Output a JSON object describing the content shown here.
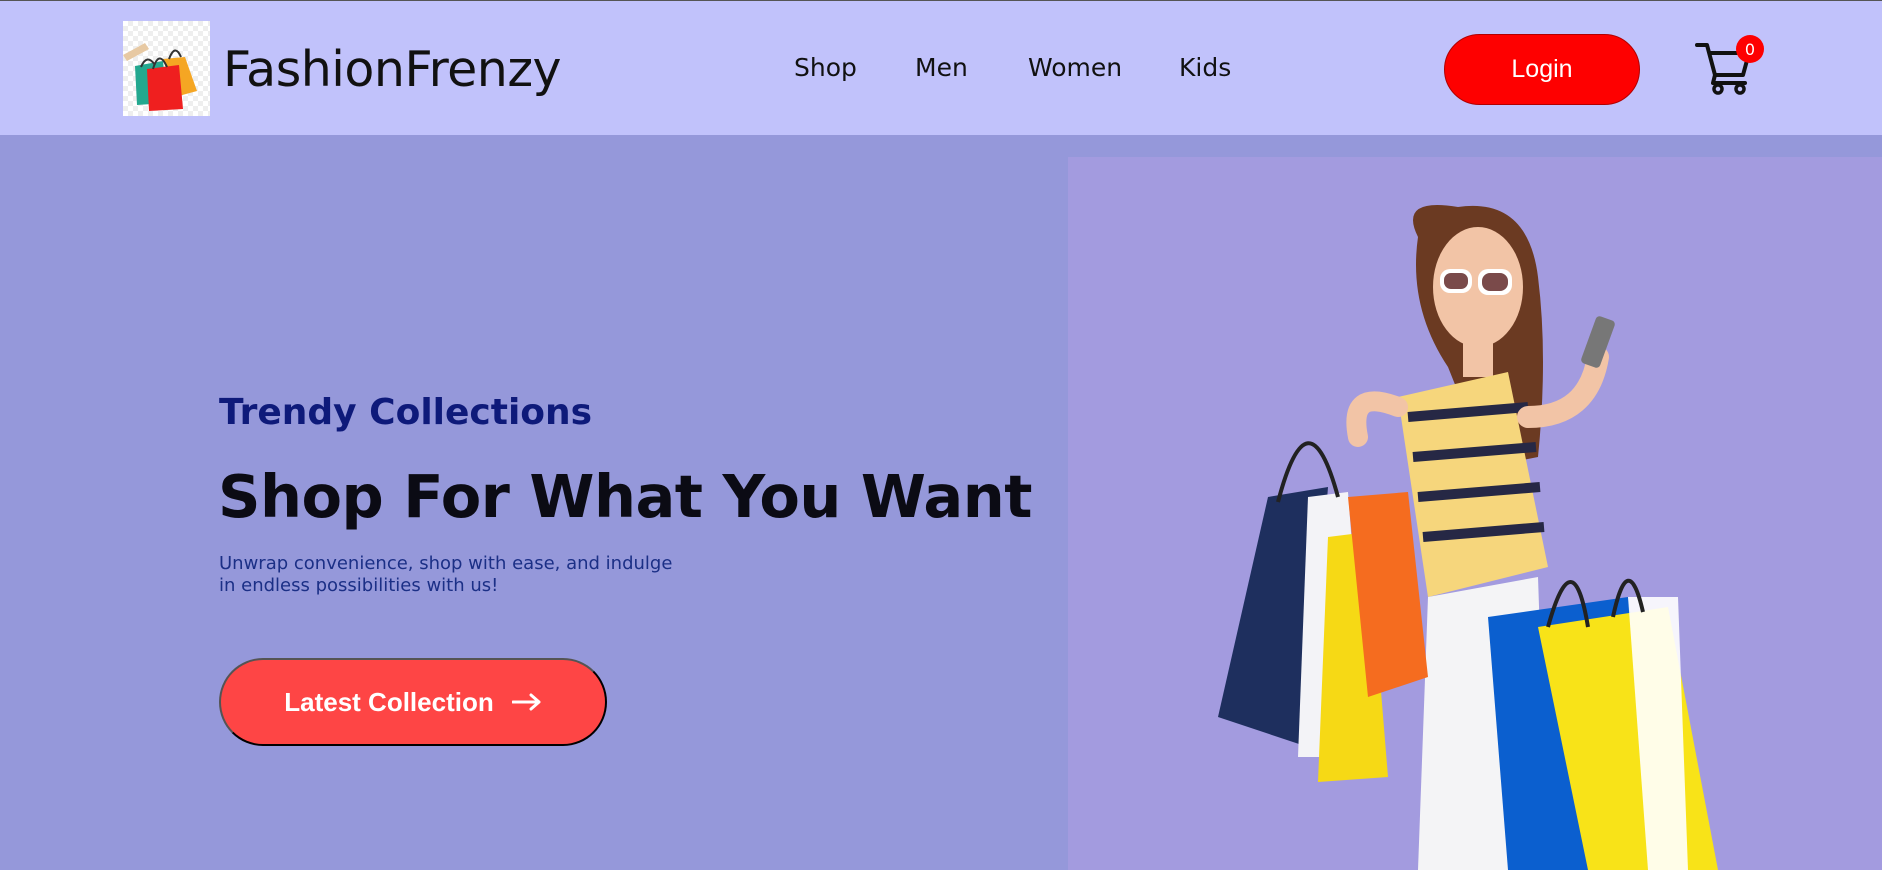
{
  "header": {
    "brand_name": "FashionFrenzy",
    "logo_icon": "shopping-bags-icon",
    "nav": [
      "Shop",
      "Men",
      "Women",
      "Kids"
    ],
    "login_label": "Login",
    "cart_icon": "cart-icon",
    "cart_count": "0"
  },
  "hero": {
    "kicker": "Trendy Collections",
    "headline": "Shop For What You Want",
    "subtext": "Unwrap convenience, shop with ease, and indulge in endless possibilities with us!",
    "cta_label": "Latest Collection",
    "cta_icon": "arrow-right-icon",
    "image_icon": "woman-with-shopping-bags-photo"
  },
  "colors": {
    "header_bg": "#c1c2fb",
    "hero_bg": "#9598da",
    "login_bg": "#fe0000",
    "cta_bg": "#fe4545",
    "kicker": "#0e1a7a"
  }
}
